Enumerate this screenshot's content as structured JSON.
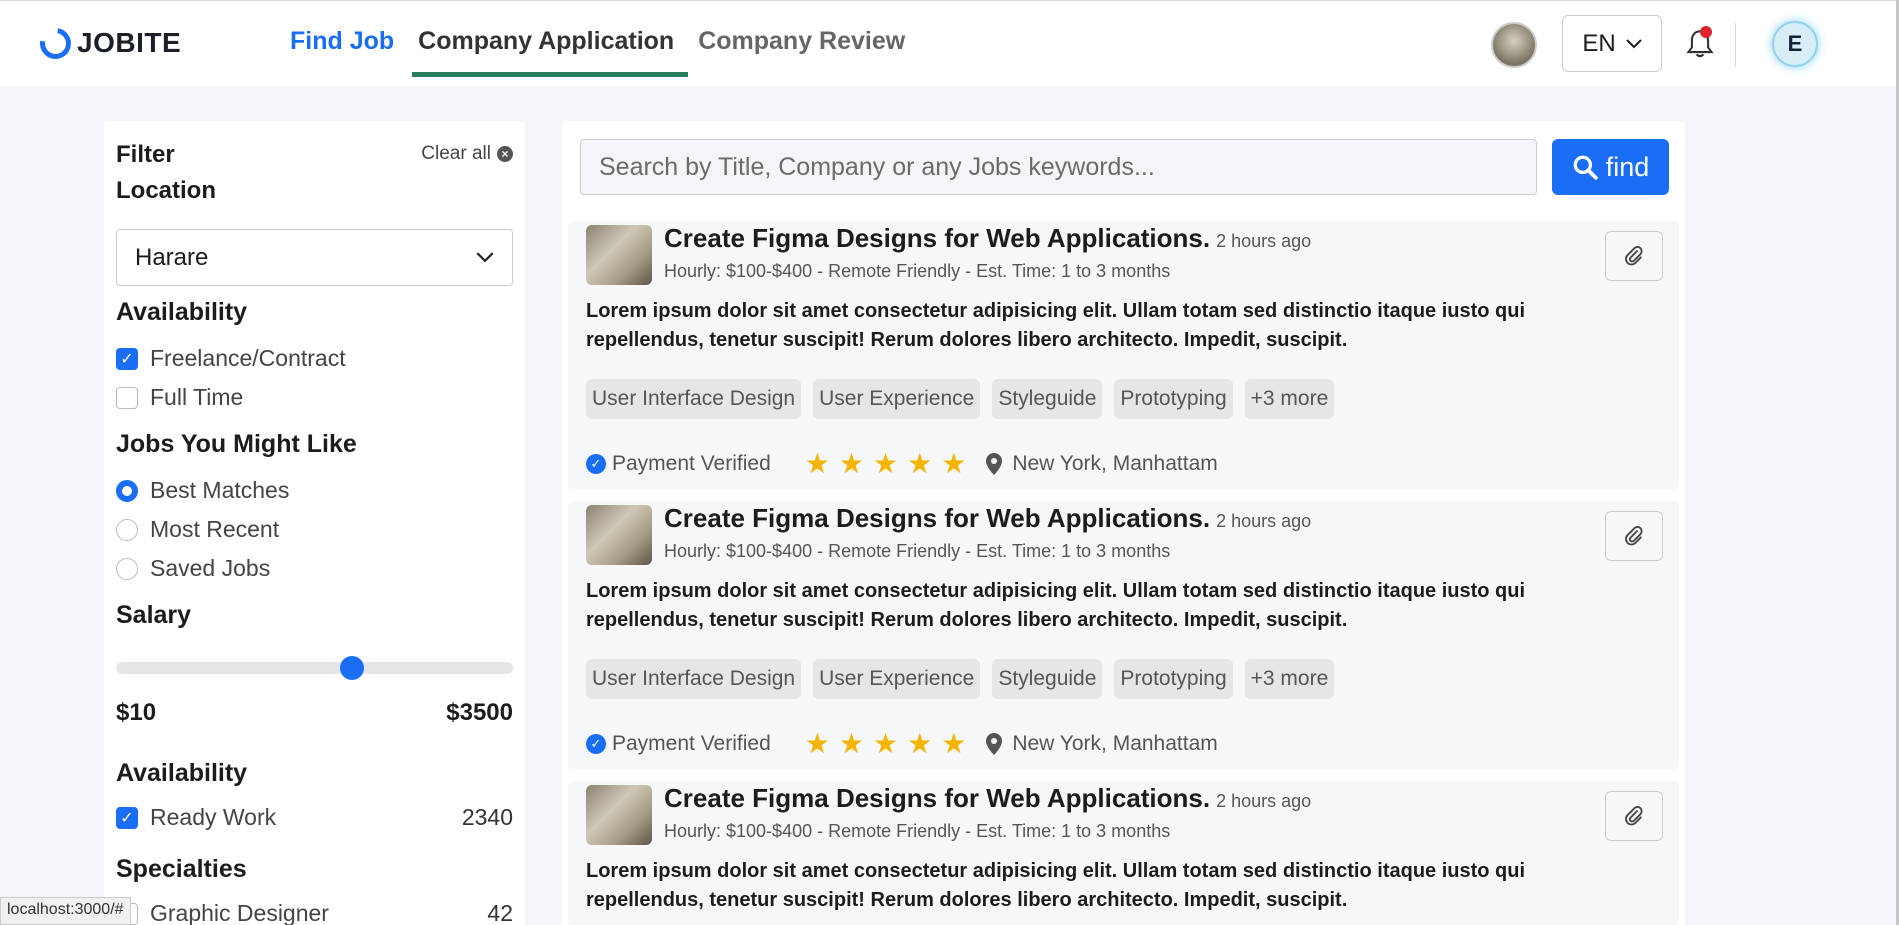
{
  "header": {
    "logo_text": "JOBITE",
    "nav": [
      "Find Job",
      "Company Application",
      "Company Review"
    ],
    "active_tab": "Company Application",
    "language": "EN",
    "user_initial": "E"
  },
  "filter": {
    "title": "Filter Location",
    "clear_all": "Clear all",
    "location_selected": "Harare",
    "availability_heading": "Availability",
    "availability_options": [
      {
        "label": "Freelance/Contract",
        "checked": true
      },
      {
        "label": "Full Time",
        "checked": false
      }
    ],
    "jobs_heading": "Jobs You Might Like",
    "jobs_options": [
      {
        "label": "Best Matches",
        "selected": true
      },
      {
        "label": "Most Recent",
        "selected": false
      },
      {
        "label": "Saved Jobs",
        "selected": false
      }
    ],
    "salary_heading": "Salary",
    "salary_min": "$10",
    "salary_max": "$3500",
    "salary_slider_fraction": 0.6,
    "availability2_heading": "Availability",
    "ready_work_label": "Ready Work",
    "ready_work_checked": true,
    "ready_work_count": "2340",
    "specialties_heading": "Specialties",
    "specialty_label": "Graphic Designer",
    "specialty_count": "42"
  },
  "search": {
    "placeholder": "Search by Title, Company or any Jobs keywords...",
    "button_label": "find"
  },
  "jobs": [
    {
      "title": "Create Figma Designs for Web Applications.",
      "time": "2 hours ago",
      "meta": "Hourly: $100-$400 - Remote Friendly - Est. Time: 1 to 3 months",
      "description": "Lorem ipsum dolor sit amet consectetur adipisicing elit. Ullam totam sed distinctio itaque iusto qui repellendus, tenetur suscipit! Rerum dolores libero architecto. Impedit, suscipit.",
      "tags": [
        "User Interface Design",
        "User Experience",
        "Styleguide",
        "Prototyping",
        "+3 more"
      ],
      "payment": "Payment Verified",
      "rating": 5,
      "location": "New York, Manhattam"
    },
    {
      "title": "Create Figma Designs for Web Applications.",
      "time": "2 hours ago",
      "meta": "Hourly: $100-$400 - Remote Friendly - Est. Time: 1 to 3 months",
      "description": "Lorem ipsum dolor sit amet consectetur adipisicing elit. Ullam totam sed distinctio itaque iusto qui repellendus, tenetur suscipit! Rerum dolores libero architecto. Impedit, suscipit.",
      "tags": [
        "User Interface Design",
        "User Experience",
        "Styleguide",
        "Prototyping",
        "+3 more"
      ],
      "payment": "Payment Verified",
      "rating": 5,
      "location": "New York, Manhattam"
    },
    {
      "title": "Create Figma Designs for Web Applications.",
      "time": "2 hours ago",
      "meta": "Hourly: $100-$400 - Remote Friendly - Est. Time: 1 to 3 months",
      "description": "Lorem ipsum dolor sit amet consectetur adipisicing elit. Ullam totam sed distinctio itaque iusto qui repellendus, tenetur suscipit! Rerum dolores libero architecto. Impedit, suscipit."
    }
  ],
  "status_url": "localhost:3000/#",
  "colors": {
    "accent": "#1a6ef5",
    "active_underline": "#2a7b5c",
    "star": "#f4b400",
    "notification": "#e0262c"
  }
}
